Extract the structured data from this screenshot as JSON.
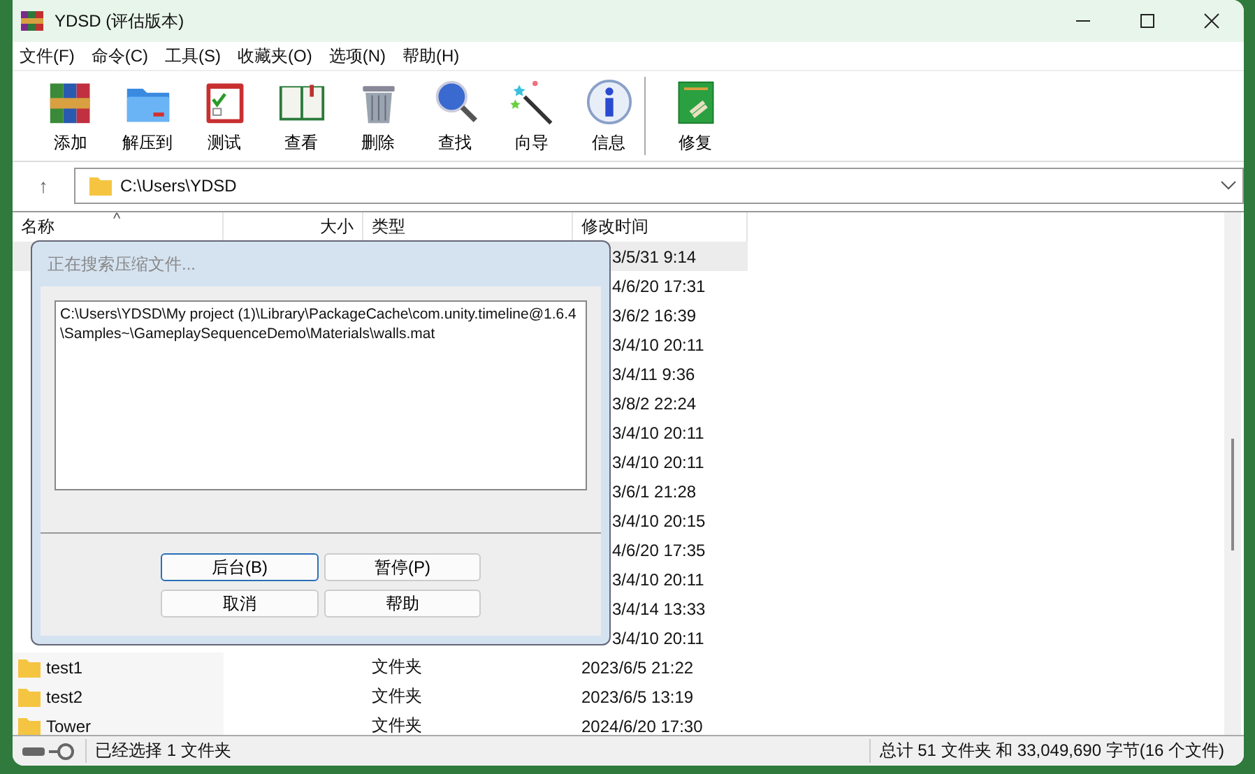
{
  "window": {
    "title": "YDSD (评估版本)"
  },
  "menu": [
    {
      "label": "文件(F)"
    },
    {
      "label": "命令(C)"
    },
    {
      "label": "工具(S)"
    },
    {
      "label": "收藏夹(O)"
    },
    {
      "label": "选项(N)"
    },
    {
      "label": "帮助(H)"
    }
  ],
  "toolbar": [
    {
      "kind": "add",
      "label": "添加"
    },
    {
      "kind": "extract",
      "label": "解压到"
    },
    {
      "kind": "test",
      "label": "测试"
    },
    {
      "kind": "view",
      "label": "查看"
    },
    {
      "kind": "delete",
      "label": "删除"
    },
    {
      "kind": "find",
      "label": "查找"
    },
    {
      "kind": "wizard",
      "label": "向导"
    },
    {
      "kind": "info",
      "label": "信息"
    },
    {
      "kind": "repair",
      "label": "修复"
    }
  ],
  "address": {
    "up": "↑",
    "path": "C:\\Users\\YDSD"
  },
  "table": {
    "columns": [
      {
        "label": "名称",
        "sort": "^"
      },
      {
        "label": "大小"
      },
      {
        "label": "类型"
      },
      {
        "label": "修改时间"
      }
    ],
    "rows": [
      {
        "date": "3/5/31 9:14",
        "selected": true
      },
      {
        "date": "4/6/20 17:31",
        "selected": false
      },
      {
        "date": "3/6/2 16:39",
        "selected": false
      },
      {
        "date": "3/4/10 20:11",
        "selected": false
      },
      {
        "date": "3/4/11 9:36",
        "selected": false
      },
      {
        "date": "3/8/2 22:24",
        "selected": false
      },
      {
        "date": "3/4/10 20:11",
        "selected": false
      },
      {
        "date": "3/4/10 20:11",
        "selected": false
      },
      {
        "date": "3/6/1 21:28",
        "selected": false
      },
      {
        "date": "3/4/10 20:15",
        "selected": false
      },
      {
        "date": "4/6/20 17:35",
        "selected": false
      },
      {
        "date": "3/4/10 20:11",
        "selected": false
      },
      {
        "date": "3/4/14 13:33",
        "selected": false
      },
      {
        "date": "3/4/10 20:11",
        "selected": false
      },
      {
        "name": "test1",
        "type": "文件夹",
        "date": "2023/6/5 21:22",
        "selected": false
      },
      {
        "name": "test2",
        "type": "文件夹",
        "date": "2023/6/5 13:19",
        "selected": false
      },
      {
        "name": "Tower",
        "type": "文件夹",
        "date": "2024/6/20 17:30",
        "selected": false
      }
    ]
  },
  "dialog": {
    "title": "正在搜索压缩文件...",
    "text": "C:\\Users\\YDSD\\My project (1)\\Library\\PackageCache\\com.unity.timeline@1.6.4\\Samples~\\GameplaySequenceDemo\\Materials\\walls.mat",
    "buttons": [
      {
        "label": "后台(B)",
        "selected": true
      },
      {
        "label": "暂停(P)",
        "selected": false
      },
      {
        "label": "取消",
        "selected": false
      },
      {
        "label": "帮助",
        "selected": false
      }
    ]
  },
  "status_bar": {
    "left": "已经选择 1 文件夹",
    "right": "总计 51 文件夹 和 33,049,690 字节(16 个文件)"
  }
}
